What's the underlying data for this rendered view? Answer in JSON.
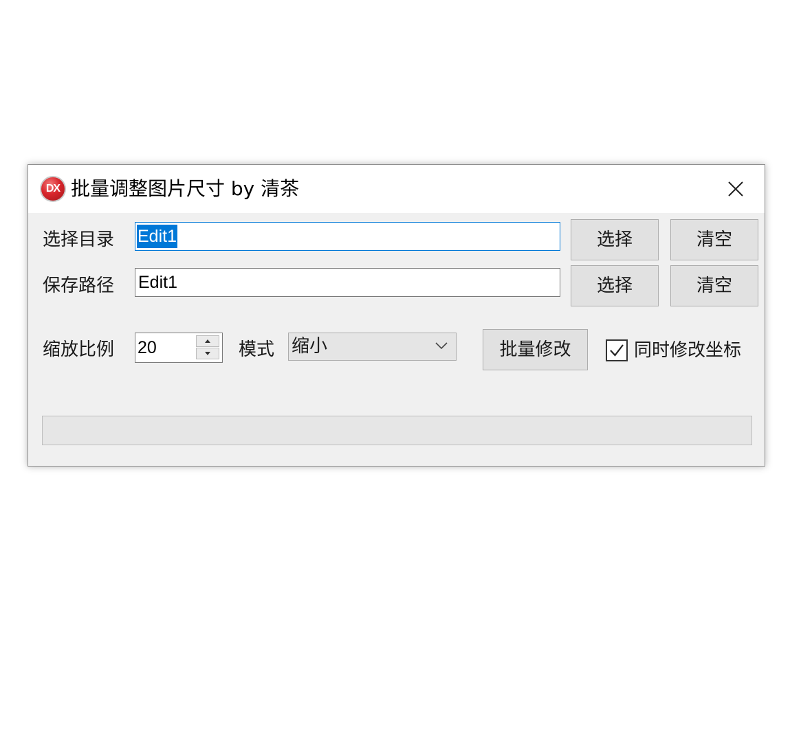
{
  "window": {
    "title": "批量调整图片尺寸 by 清茶",
    "icon_text": "DX"
  },
  "source": {
    "label": "选择目录",
    "value": "Edit1",
    "select_label": "选择",
    "clear_label": "清空"
  },
  "save": {
    "label": "保存路径",
    "value": "Edit1",
    "select_label": "选择",
    "clear_label": "清空"
  },
  "scale": {
    "label": "缩放比例",
    "value": "20"
  },
  "mode": {
    "label": "模式",
    "value": "缩小"
  },
  "batch_button_label": "批量修改",
  "sync_coords": {
    "label": "同时修改坐标",
    "checked": true
  },
  "progress": {
    "fraction": 0
  },
  "icons": {
    "close": "close-icon",
    "spin_up": "arrow-up-icon",
    "spin_down": "arrow-down-icon",
    "dropdown": "chevron-down-icon",
    "check": "check-icon",
    "app": "app-logo-icon"
  },
  "colors": {
    "accent": "#0078d7",
    "window_bg": "#f0f0f0",
    "button_bg": "#e1e1e1",
    "app_icon_red": "#d8262c",
    "progress_fill": "#06b025"
  }
}
